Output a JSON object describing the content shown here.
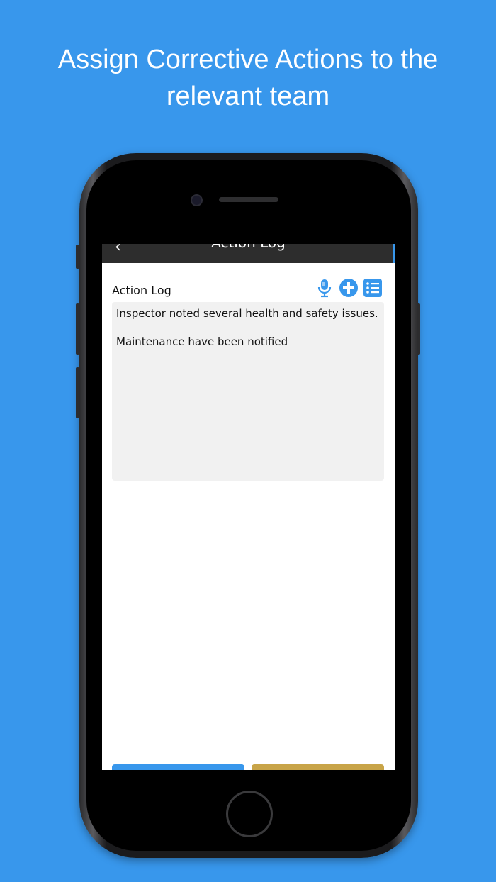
{
  "headline": {
    "line1": "Assign Corrective Actions to the",
    "line2": "relevant team"
  },
  "navbar": {
    "title": "Action Log",
    "back_glyph": "‹"
  },
  "action_log": {
    "label": "Action Log",
    "entries": [
      "Inspector noted several health and safety issues.",
      "Maintenance have been notified"
    ]
  },
  "toolbar": {
    "icons": [
      "microphone-icon",
      "plus-circle-icon",
      "list-icon"
    ]
  },
  "colors": {
    "background": "#3897ec",
    "accent_blue": "#3897ec",
    "accent_gold": "#c8a448",
    "navbar": "#2d2d2d",
    "text_area": "#f1f1f1"
  }
}
